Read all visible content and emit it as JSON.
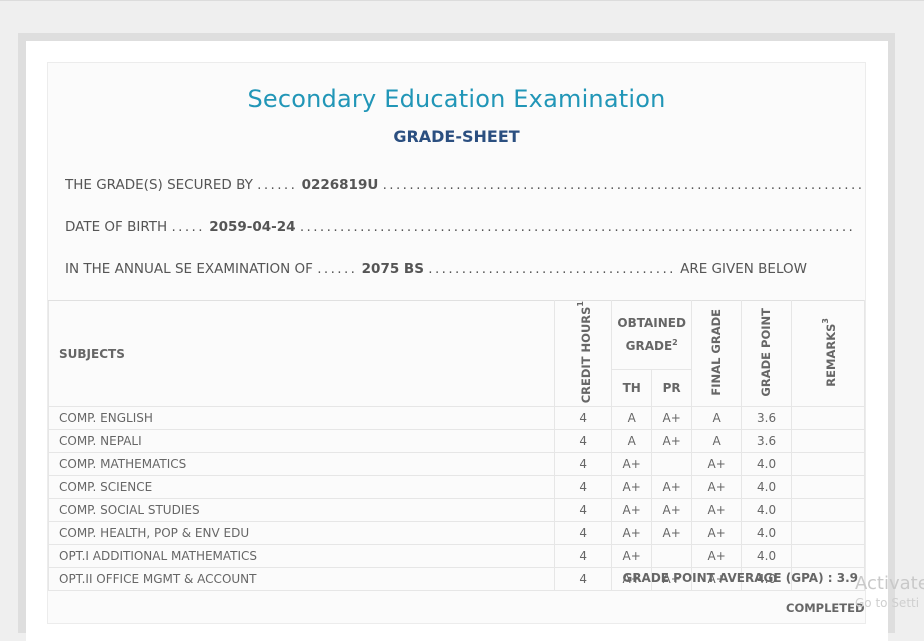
{
  "title": "Secondary Education Examination",
  "subtitle": "GRADE-SHEET",
  "secured_by": {
    "label": "THE GRADE(S) SECURED BY",
    "value": "0226819U"
  },
  "dob": {
    "label": "DATE OF BIRTH",
    "value": "2059-04-24"
  },
  "exam": {
    "label": "IN THE ANNUAL SE EXAMINATION OF",
    "value": "2075 BS",
    "suffix": "ARE GIVEN BELOW"
  },
  "dots": {
    "short6": "......",
    "short5": ".....",
    "long1": "...................................................................................",
    "long2": "...................................................................................",
    "mid3": "....................................."
  },
  "table": {
    "headers": {
      "subjects": "SUBJECTS",
      "credit_hours": "CREDIT HOURS",
      "credit_sup": "1",
      "obtained_grade": "OBTAINED GRADE",
      "obtained_sup": "2",
      "th": "TH",
      "pr": "PR",
      "final_grade": "FINAL GRADE",
      "grade_point": "GRADE POINT",
      "remarks": "REMARKS",
      "remarks_sup": "3"
    },
    "rows": [
      {
        "subject": "COMP. ENGLISH",
        "credit": "4",
        "th": "A",
        "pr": "A+",
        "final": "A",
        "gp": "3.6",
        "remarks": ""
      },
      {
        "subject": "COMP. NEPALI",
        "credit": "4",
        "th": "A",
        "pr": "A+",
        "final": "A",
        "gp": "3.6",
        "remarks": ""
      },
      {
        "subject": "COMP. MATHEMATICS",
        "credit": "4",
        "th": "A+",
        "pr": "",
        "final": "A+",
        "gp": "4.0",
        "remarks": ""
      },
      {
        "subject": "COMP. SCIENCE",
        "credit": "4",
        "th": "A+",
        "pr": "A+",
        "final": "A+",
        "gp": "4.0",
        "remarks": ""
      },
      {
        "subject": "COMP. SOCIAL STUDIES",
        "credit": "4",
        "th": "A+",
        "pr": "A+",
        "final": "A+",
        "gp": "4.0",
        "remarks": ""
      },
      {
        "subject": "COMP. HEALTH, POP & ENV EDU",
        "credit": "4",
        "th": "A+",
        "pr": "A+",
        "final": "A+",
        "gp": "4.0",
        "remarks": ""
      },
      {
        "subject": "OPT.I ADDITIONAL MATHEMATICS",
        "credit": "4",
        "th": "A+",
        "pr": "",
        "final": "A+",
        "gp": "4.0",
        "remarks": ""
      },
      {
        "subject": "OPT.II OFFICE MGMT & ACCOUNT",
        "credit": "4",
        "th": "A+",
        "pr": "A+",
        "final": "A+",
        "gp": "4.0",
        "remarks": ""
      }
    ]
  },
  "gpa": {
    "label": "GRADE POINT AVERAGE (GPA) :",
    "value": "3.9"
  },
  "completed": "COMPLETED",
  "watermark": {
    "line1": "Activate",
    "line2": "Go to Setti"
  }
}
